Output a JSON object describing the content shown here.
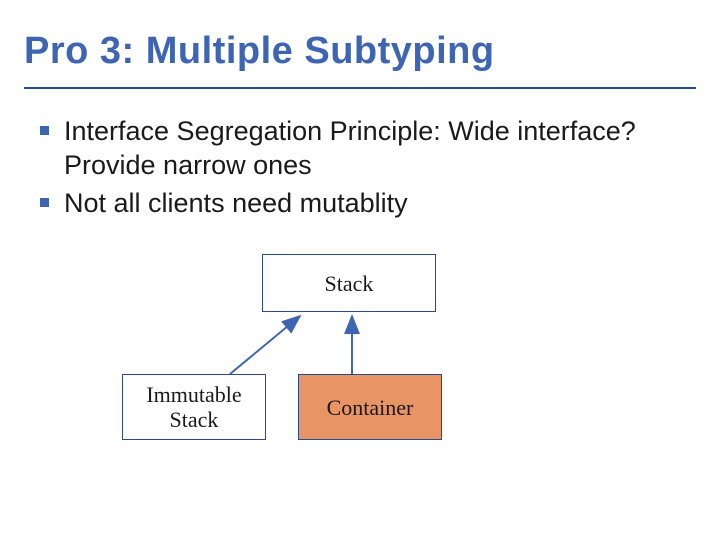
{
  "title": "Pro 3: Multiple Subtyping",
  "bullets": [
    "Interface Segregation Principle: Wide interface? Provide narrow ones",
    "Not all clients need mutablity"
  ],
  "diagram": {
    "top_box": "Stack",
    "left_box": "Immutable\nStack",
    "right_box": "Container"
  }
}
